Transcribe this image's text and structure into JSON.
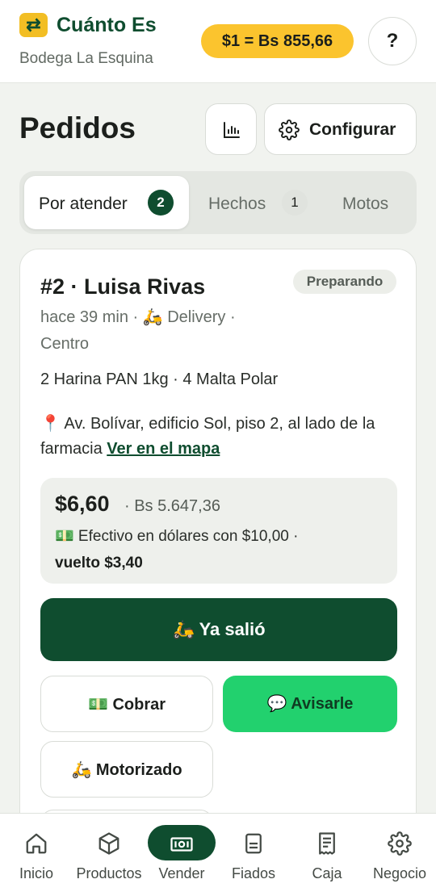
{
  "app": {
    "logo_glyph": "⇄",
    "name": "Cuánto Es",
    "business": "Bodega La Esquina",
    "rate": "$1 = Bs 855,66",
    "help": "?"
  },
  "header": {
    "title": "Pedidos",
    "config_label": "Configurar"
  },
  "tabs": [
    {
      "label": "Por atender",
      "count": "2"
    },
    {
      "label": "Hechos",
      "count": "1"
    },
    {
      "label": "Motos"
    }
  ],
  "order": {
    "title": "#2 · Luisa Rivas",
    "status": "Preparando",
    "meta": "hace 39 min · 🛵 Delivery · Centro",
    "items": "2 Harina PAN 1kg · 4 Malta Polar",
    "address": "📍 Av. Bolívar, edificio Sol, piso 2, al lado de la farmacia",
    "map_link": "Ver en el mapa",
    "total_usd": "$6,60",
    "total_bs": "· Bs 5.647,36",
    "payment": "💵 Efectivo en dólares con $10,00 ·",
    "change": "vuelto $3,40",
    "primary_action": "🛵 Ya salió",
    "charge_action": "💵 Cobrar",
    "notify_action": "💬 Avisarle",
    "rider_action": "🛵 Motorizado"
  },
  "nav": [
    {
      "label": "Inicio",
      "icon": "home-icon"
    },
    {
      "label": "Productos",
      "icon": "box-icon"
    },
    {
      "label": "Vender",
      "icon": "cash-icon",
      "active": true
    },
    {
      "label": "Fiados",
      "icon": "ledger-icon"
    },
    {
      "label": "Caja",
      "icon": "receipt-icon"
    },
    {
      "label": "Negocio",
      "icon": "gear-icon"
    }
  ],
  "colors": {
    "brand": "#0f4d2f",
    "accent_yellow": "#fbc42e",
    "whatsapp_green": "#22d16e"
  }
}
